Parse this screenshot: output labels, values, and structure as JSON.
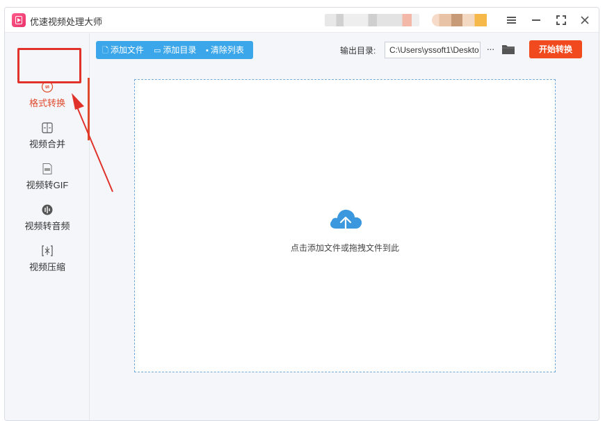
{
  "app": {
    "title": "优速视频处理大师"
  },
  "toolbar": {
    "add_file": "添加文件",
    "add_dir": "添加目录",
    "clear_list": "清除列表",
    "output_label": "输出目录:",
    "output_path": "C:\\Users\\yssoft1\\Deskto",
    "more_label": "···",
    "start_label": "开始转换"
  },
  "sidebar": {
    "items": [
      {
        "label": "格式转换",
        "icon": "format-convert-icon",
        "active": true
      },
      {
        "label": "视频合并",
        "icon": "merge-icon",
        "active": false
      },
      {
        "label": "视频转GIF",
        "icon": "gif-icon",
        "active": false
      },
      {
        "label": "视频转音频",
        "icon": "audio-icon",
        "active": false
      },
      {
        "label": "视频压缩",
        "icon": "compress-icon",
        "active": false
      }
    ]
  },
  "dropzone": {
    "hint": "点击添加文件或拖拽文件到此"
  },
  "colors": {
    "accent_blue": "#3ba7ea",
    "start_orange": "#f04a1e",
    "highlight_red": "#e0322a",
    "active_text": "#e04a2c"
  }
}
